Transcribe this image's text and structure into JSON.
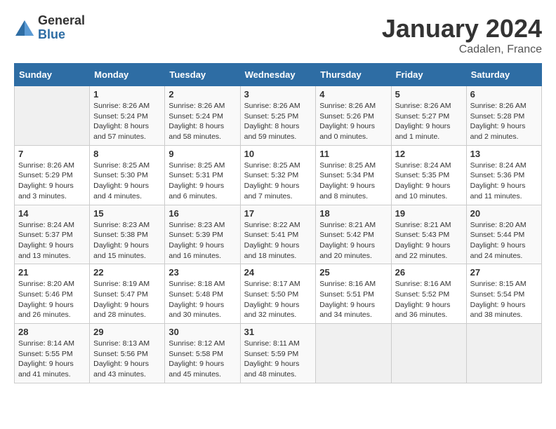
{
  "logo": {
    "general": "General",
    "blue": "Blue"
  },
  "title": "January 2024",
  "location": "Cadalen, France",
  "days_header": [
    "Sunday",
    "Monday",
    "Tuesday",
    "Wednesday",
    "Thursday",
    "Friday",
    "Saturday"
  ],
  "weeks": [
    [
      {
        "day": "",
        "info": ""
      },
      {
        "day": "1",
        "info": "Sunrise: 8:26 AM\nSunset: 5:24 PM\nDaylight: 8 hours\nand 57 minutes."
      },
      {
        "day": "2",
        "info": "Sunrise: 8:26 AM\nSunset: 5:24 PM\nDaylight: 8 hours\nand 58 minutes."
      },
      {
        "day": "3",
        "info": "Sunrise: 8:26 AM\nSunset: 5:25 PM\nDaylight: 8 hours\nand 59 minutes."
      },
      {
        "day": "4",
        "info": "Sunrise: 8:26 AM\nSunset: 5:26 PM\nDaylight: 9 hours\nand 0 minutes."
      },
      {
        "day": "5",
        "info": "Sunrise: 8:26 AM\nSunset: 5:27 PM\nDaylight: 9 hours\nand 1 minute."
      },
      {
        "day": "6",
        "info": "Sunrise: 8:26 AM\nSunset: 5:28 PM\nDaylight: 9 hours\nand 2 minutes."
      }
    ],
    [
      {
        "day": "7",
        "info": "Sunrise: 8:26 AM\nSunset: 5:29 PM\nDaylight: 9 hours\nand 3 minutes."
      },
      {
        "day": "8",
        "info": "Sunrise: 8:25 AM\nSunset: 5:30 PM\nDaylight: 9 hours\nand 4 minutes."
      },
      {
        "day": "9",
        "info": "Sunrise: 8:25 AM\nSunset: 5:31 PM\nDaylight: 9 hours\nand 6 minutes."
      },
      {
        "day": "10",
        "info": "Sunrise: 8:25 AM\nSunset: 5:32 PM\nDaylight: 9 hours\nand 7 minutes."
      },
      {
        "day": "11",
        "info": "Sunrise: 8:25 AM\nSunset: 5:34 PM\nDaylight: 9 hours\nand 8 minutes."
      },
      {
        "day": "12",
        "info": "Sunrise: 8:24 AM\nSunset: 5:35 PM\nDaylight: 9 hours\nand 10 minutes."
      },
      {
        "day": "13",
        "info": "Sunrise: 8:24 AM\nSunset: 5:36 PM\nDaylight: 9 hours\nand 11 minutes."
      }
    ],
    [
      {
        "day": "14",
        "info": "Sunrise: 8:24 AM\nSunset: 5:37 PM\nDaylight: 9 hours\nand 13 minutes."
      },
      {
        "day": "15",
        "info": "Sunrise: 8:23 AM\nSunset: 5:38 PM\nDaylight: 9 hours\nand 15 minutes."
      },
      {
        "day": "16",
        "info": "Sunrise: 8:23 AM\nSunset: 5:39 PM\nDaylight: 9 hours\nand 16 minutes."
      },
      {
        "day": "17",
        "info": "Sunrise: 8:22 AM\nSunset: 5:41 PM\nDaylight: 9 hours\nand 18 minutes."
      },
      {
        "day": "18",
        "info": "Sunrise: 8:21 AM\nSunset: 5:42 PM\nDaylight: 9 hours\nand 20 minutes."
      },
      {
        "day": "19",
        "info": "Sunrise: 8:21 AM\nSunset: 5:43 PM\nDaylight: 9 hours\nand 22 minutes."
      },
      {
        "day": "20",
        "info": "Sunrise: 8:20 AM\nSunset: 5:44 PM\nDaylight: 9 hours\nand 24 minutes."
      }
    ],
    [
      {
        "day": "21",
        "info": "Sunrise: 8:20 AM\nSunset: 5:46 PM\nDaylight: 9 hours\nand 26 minutes."
      },
      {
        "day": "22",
        "info": "Sunrise: 8:19 AM\nSunset: 5:47 PM\nDaylight: 9 hours\nand 28 minutes."
      },
      {
        "day": "23",
        "info": "Sunrise: 8:18 AM\nSunset: 5:48 PM\nDaylight: 9 hours\nand 30 minutes."
      },
      {
        "day": "24",
        "info": "Sunrise: 8:17 AM\nSunset: 5:50 PM\nDaylight: 9 hours\nand 32 minutes."
      },
      {
        "day": "25",
        "info": "Sunrise: 8:16 AM\nSunset: 5:51 PM\nDaylight: 9 hours\nand 34 minutes."
      },
      {
        "day": "26",
        "info": "Sunrise: 8:16 AM\nSunset: 5:52 PM\nDaylight: 9 hours\nand 36 minutes."
      },
      {
        "day": "27",
        "info": "Sunrise: 8:15 AM\nSunset: 5:54 PM\nDaylight: 9 hours\nand 38 minutes."
      }
    ],
    [
      {
        "day": "28",
        "info": "Sunrise: 8:14 AM\nSunset: 5:55 PM\nDaylight: 9 hours\nand 41 minutes."
      },
      {
        "day": "29",
        "info": "Sunrise: 8:13 AM\nSunset: 5:56 PM\nDaylight: 9 hours\nand 43 minutes."
      },
      {
        "day": "30",
        "info": "Sunrise: 8:12 AM\nSunset: 5:58 PM\nDaylight: 9 hours\nand 45 minutes."
      },
      {
        "day": "31",
        "info": "Sunrise: 8:11 AM\nSunset: 5:59 PM\nDaylight: 9 hours\nand 48 minutes."
      },
      {
        "day": "",
        "info": ""
      },
      {
        "day": "",
        "info": ""
      },
      {
        "day": "",
        "info": ""
      }
    ]
  ]
}
